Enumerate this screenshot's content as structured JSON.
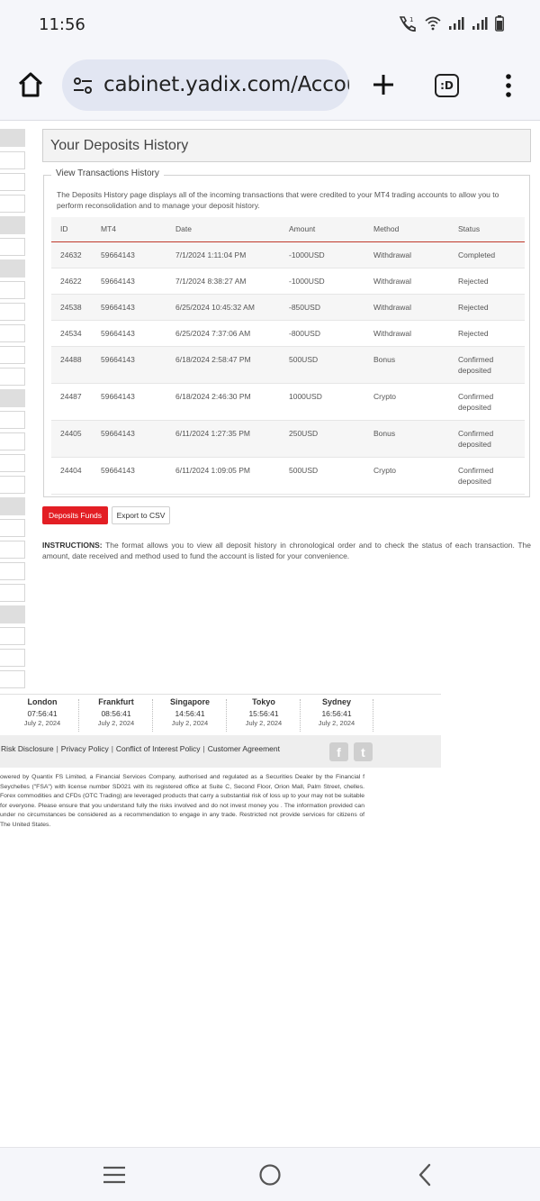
{
  "status_bar": {
    "time": "11:56"
  },
  "browser": {
    "url": "cabinet.yadix.com/Accou",
    "tabs_label": ":D"
  },
  "page": {
    "title": "Your Deposits History",
    "section_legend": "View Transactions History",
    "description": "The Deposits History page displays all of the incoming transactions that were credited to your MT4 trading accounts to allow you to perform reconsolidation and to manage your deposit history.",
    "table": {
      "headers": [
        "ID",
        "MT4",
        "Date",
        "Amount",
        "Method",
        "Status"
      ],
      "rows": [
        [
          "24632",
          "59664143",
          "7/1/2024 1:11:04 PM",
          "-1000USD",
          "Withdrawal",
          "Completed"
        ],
        [
          "24622",
          "59664143",
          "7/1/2024 8:38:27 AM",
          "-1000USD",
          "Withdrawal",
          "Rejected"
        ],
        [
          "24538",
          "59664143",
          "6/25/2024 10:45:32 AM",
          "-850USD",
          "Withdrawal",
          "Rejected"
        ],
        [
          "24534",
          "59664143",
          "6/25/2024 7:37:06 AM",
          "-800USD",
          "Withdrawal",
          "Rejected"
        ],
        [
          "24488",
          "59664143",
          "6/18/2024 2:58:47 PM",
          "500USD",
          "Bonus",
          "Confirmed deposited"
        ],
        [
          "24487",
          "59664143",
          "6/18/2024 2:46:30 PM",
          "1000USD",
          "Crypto",
          "Confirmed deposited"
        ],
        [
          "24405",
          "59664143",
          "6/11/2024 1:27:35 PM",
          "250USD",
          "Bonus",
          "Confirmed deposited"
        ],
        [
          "24404",
          "59664143",
          "6/11/2024 1:09:05 PM",
          "500USD",
          "Crypto",
          "Confirmed deposited"
        ]
      ]
    },
    "buttons": {
      "deposit": "Deposits Funds",
      "export": "Export to CSV"
    },
    "instructions_label": "INSTRUCTIONS:",
    "instructions_text": " The format allows you to view all deposit history in chronological order and to check the status of each transaction. The amount, date received and method used to fund the account is listed for your convenience."
  },
  "clocks": [
    {
      "city": "London",
      "time": "07:56:41",
      "date": "July 2, 2024"
    },
    {
      "city": "Frankfurt",
      "time": "08:56:41",
      "date": "July 2, 2024"
    },
    {
      "city": "Singapore",
      "time": "14:56:41",
      "date": "July 2, 2024"
    },
    {
      "city": "Tokyo",
      "time": "15:56:41",
      "date": "July 2, 2024"
    },
    {
      "city": "Sydney",
      "time": "16:56:41",
      "date": "July 2, 2024"
    }
  ],
  "footer": {
    "links": [
      "Risk Disclosure",
      "Privacy Policy",
      "Conflict of Interest Policy",
      "Customer Agreement"
    ],
    "social": {
      "facebook": "f",
      "twitter": "t"
    },
    "disclaimer": "owered by Quantix FS Limited, a Financial Services Company, authorised and regulated as a Securities Dealer by the Financial f Seychelles (\"FSA\") with license number SD021 with its registered office at Suite C, Second Floor, Orion Mall, Palm Street, chelles. Forex commodities and CFDs (OTC Trading) are leveraged products that carry a substantial risk of loss up to your may not be suitable for everyone. Please ensure that you understand fully the risks involved and do not invest money you . The information provided can under no circumstances be considered as a recommendation to engage in any trade. Restricted not provide services for citizens of The United States."
  },
  "colors": {
    "accent": "#e31e24",
    "url_bar": "#e2e6f2",
    "chrome_bg": "#f5f6fa"
  }
}
